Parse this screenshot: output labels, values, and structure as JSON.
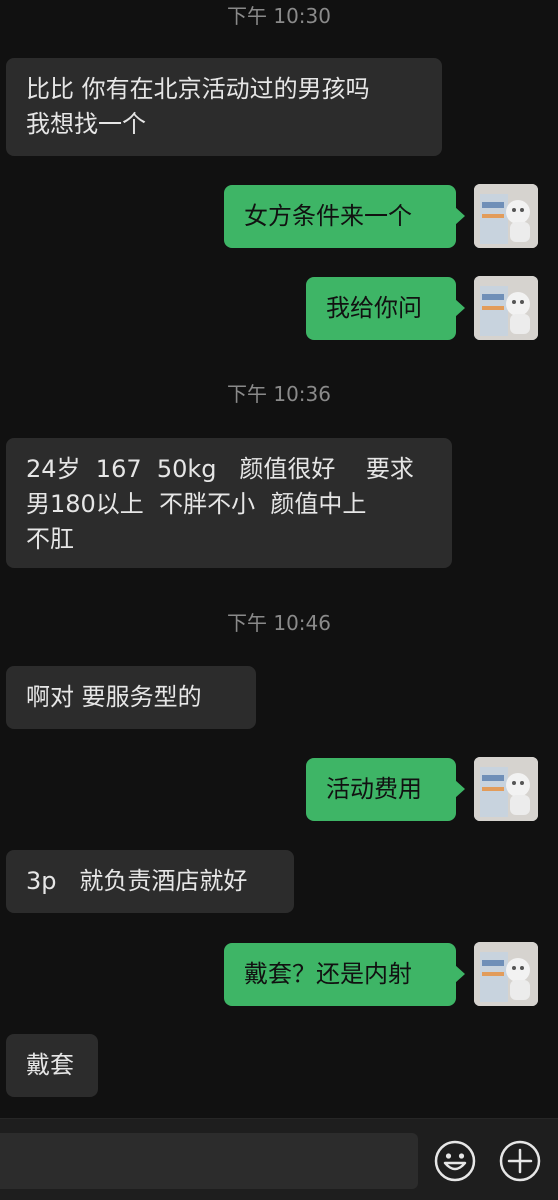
{
  "chat": {
    "messages": [
      {
        "type": "time",
        "text": "下午 10:30"
      },
      {
        "type": "in",
        "text": "比比 你有在北京活动过的男孩吗\n我想找一个"
      },
      {
        "type": "out",
        "text": "女方条件来一个"
      },
      {
        "type": "out",
        "text": "我给你问"
      },
      {
        "type": "time",
        "text": "下午 10:36"
      },
      {
        "type": "in",
        "text": "24岁  167  50kg   颜值很好    要求\n男180以上  不胖不小  颜值中上\n不肛"
      },
      {
        "type": "time",
        "text": "下午 10:46"
      },
      {
        "type": "in",
        "text": "啊对 要服务型的"
      },
      {
        "type": "out",
        "text": "活动费用"
      },
      {
        "type": "in",
        "text": "3p   就负责酒店就好"
      },
      {
        "type": "out",
        "text": "戴套？还是内射"
      },
      {
        "type": "in",
        "text": "戴套"
      }
    ]
  },
  "input_bar": {
    "emoji_icon": "smiley-face-icon",
    "plus_icon": "plus-circle-icon"
  },
  "colors": {
    "background": "#111111",
    "incoming_bubble": "#2c2c2c",
    "outgoing_bubble": "#3eb566",
    "timestamp": "#8a8a8a"
  }
}
